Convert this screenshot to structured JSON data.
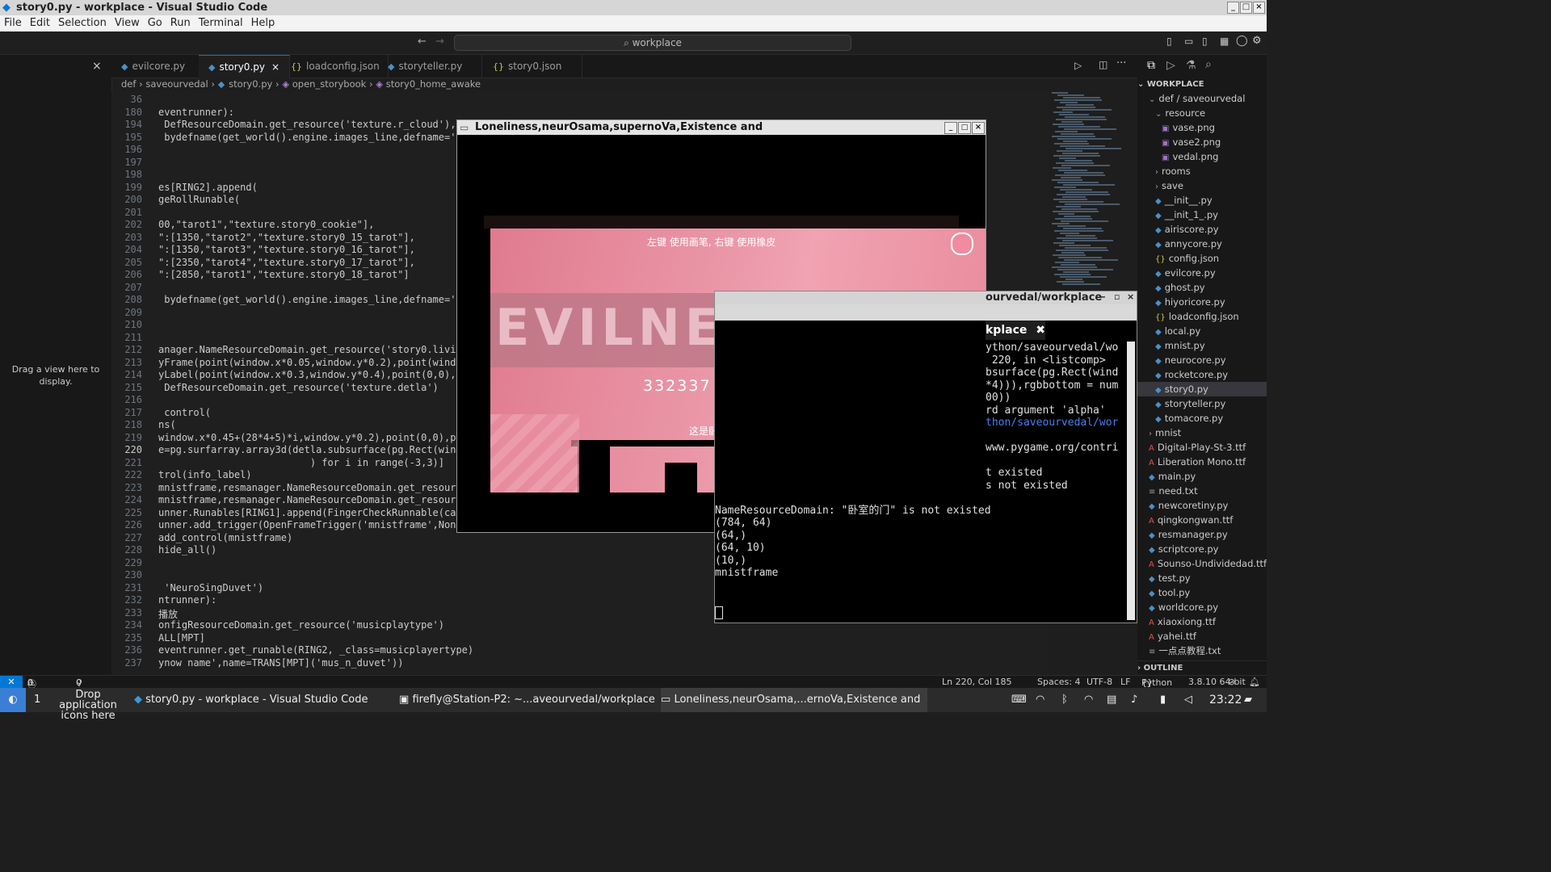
{
  "window": {
    "title": "story0.py - workplace - Visual Studio Code"
  },
  "menu": [
    "File",
    "Edit",
    "Selection",
    "View",
    "Go",
    "Run",
    "Terminal",
    "Help"
  ],
  "search": {
    "text": "workplace"
  },
  "left_panel": {
    "message": "Drag a view here to display."
  },
  "tabs": [
    {
      "label": "evilcore.py",
      "type": "py"
    },
    {
      "label": "story0.py",
      "type": "py",
      "active": true
    },
    {
      "label": "loadconfig.json",
      "type": "json"
    },
    {
      "label": "storyteller.py",
      "type": "py"
    },
    {
      "label": "story0.json",
      "type": "json"
    }
  ],
  "breadcrumb": [
    "def",
    "saveourvedal",
    "story0.py",
    "open_storybook",
    "story0_home_awake"
  ],
  "editor": {
    "lines": [
      {
        "n": "36",
        "code": ""
      },
      {
        "n": "180",
        "code": "eventrunner):"
      },
      {
        "n": "194",
        "code": " DefResourceDomain.get_resource('texture.r_cloud'),"
      },
      {
        "n": "195",
        "code": " bydefname(get_world().engine.images_line,defname='scre"
      },
      {
        "n": "196",
        "code": ""
      },
      {
        "n": "197",
        "code": ""
      },
      {
        "n": "198",
        "code": ""
      },
      {
        "n": "199",
        "code": "es[RING2].append("
      },
      {
        "n": "200",
        "code": "geRollRunable("
      },
      {
        "n": "201",
        "code": ""
      },
      {
        "n": "202",
        "code": "00,\"tarot1\",\"texture.story0_cookie\"],"
      },
      {
        "n": "203",
        "code": "\":[1350,\"tarot2\",\"texture.story0_15_tarot\"],"
      },
      {
        "n": "204",
        "code": "\":[1350,\"tarot3\",\"texture.story0_16_tarot\"],"
      },
      {
        "n": "205",
        "code": "\":[2350,\"tarot4\",\"texture.story0_17_tarot\"],"
      },
      {
        "n": "206",
        "code": "\":[2850,\"tarot1\",\"texture.story0_18_tarot\"]"
      },
      {
        "n": "207",
        "code": ""
      },
      {
        "n": "208",
        "code": " bydefname(get_world().engine.images_line,defname='cook"
      },
      {
        "n": "209",
        "code": ""
      },
      {
        "n": "210",
        "code": ""
      },
      {
        "n": "211",
        "code": ""
      },
      {
        "n": "212",
        "code": "anager.NameResourceDomain.get_resource('story0.livingro"
      },
      {
        "n": "213",
        "code": "yFrame(point(window.x*0.05,window.y*0.2),point(window.x"
      },
      {
        "n": "214",
        "code": "yLabel(point(window.x*0.3,window.y*0.4),point(0,0),'',3"
      },
      {
        "n": "215",
        "code": " DefResourceDomain.get_resource('texture.detla')"
      },
      {
        "n": "216",
        "code": ""
      },
      {
        "n": "217",
        "code": " control("
      },
      {
        "n": "218",
        "code": "ns("
      },
      {
        "n": "219",
        "code": "window.x*0.45+(28*4+5)*i,window.y*0.2),point(0,0),point"
      },
      {
        "n": "220",
        "code": "e=pg.surfarray.array3d(detla.subsurface(pg.Rect(window"
      },
      {
        "n": "221",
        "code": "                          ) for i in range(-3,3)]"
      },
      {
        "n": "222",
        "code": "trol(info_label)"
      },
      {
        "n": "223",
        "code": "mnistframe,resmanager.NameResourceDomain.get_resource('s"
      },
      {
        "n": "224",
        "code": "mnistframe,resmanager.NameResourceDomain.get_resource('s"
      },
      {
        "n": "225",
        "code": "unner.Runables[RING1].append(FingerCheckRunnable(canvas"
      },
      {
        "n": "226",
        "code": "unner.add_trigger(OpenFrameTrigger('mnistframe',None,'mnistframe'))"
      },
      {
        "n": "227",
        "code": "add_control(mnistframe)"
      },
      {
        "n": "228",
        "code": "hide_all()"
      },
      {
        "n": "229",
        "code": ""
      },
      {
        "n": "230",
        "code": ""
      },
      {
        "n": "231",
        "code": " 'NeuroSingDuvet')"
      },
      {
        "n": "232",
        "code": "ntrunner):"
      },
      {
        "n": "233",
        "code": "播放"
      },
      {
        "n": "234",
        "code": "onfigResourceDomain.get_resource('musicplaytype')"
      },
      {
        "n": "235",
        "code": "ALL[MPT]"
      },
      {
        "n": "236",
        "code": "eventrunner.get_runable(RING2, _class=musicplayertype)"
      },
      {
        "n": "237",
        "code": "ynow name',name=TRANS[MPT]('mus_n_duvet'))"
      }
    ]
  },
  "explorer": {
    "title": "WORKPLACE",
    "items": [
      {
        "label": "def / saveourvedal",
        "kind": "folder-open",
        "indent": 1
      },
      {
        "label": "resource",
        "kind": "folder-open",
        "indent": 2
      },
      {
        "label": "vase.png",
        "kind": "img",
        "indent": 3
      },
      {
        "label": "vase2.png",
        "kind": "img",
        "indent": 3
      },
      {
        "label": "vedal.png",
        "kind": "img",
        "indent": 3
      },
      {
        "label": "rooms",
        "kind": "folder",
        "indent": 2
      },
      {
        "label": "save",
        "kind": "folder",
        "indent": 2
      },
      {
        "label": "__init__.py",
        "kind": "py",
        "indent": 2
      },
      {
        "label": "__init_1_.py",
        "kind": "py",
        "indent": 2
      },
      {
        "label": "airiscore.py",
        "kind": "py",
        "indent": 2
      },
      {
        "label": "annycore.py",
        "kind": "py",
        "indent": 2
      },
      {
        "label": "config.json",
        "kind": "json",
        "indent": 2
      },
      {
        "label": "evilcore.py",
        "kind": "py",
        "indent": 2
      },
      {
        "label": "ghost.py",
        "kind": "py",
        "indent": 2
      },
      {
        "label": "hiyoricore.py",
        "kind": "py",
        "indent": 2
      },
      {
        "label": "loadconfig.json",
        "kind": "json",
        "indent": 2
      },
      {
        "label": "local.py",
        "kind": "py",
        "indent": 2
      },
      {
        "label": "mnist.py",
        "kind": "py",
        "indent": 2
      },
      {
        "label": "neurocore.py",
        "kind": "py",
        "indent": 2
      },
      {
        "label": "rocketcore.py",
        "kind": "py",
        "indent": 2
      },
      {
        "label": "story0.py",
        "kind": "py",
        "indent": 2,
        "selected": true
      },
      {
        "label": "storyteller.py",
        "kind": "py",
        "indent": 2
      },
      {
        "label": "tomacore.py",
        "kind": "py",
        "indent": 2
      },
      {
        "label": "mnist",
        "kind": "folder",
        "indent": 1
      },
      {
        "label": "Digital-Play-St-3.ttf",
        "kind": "ttf",
        "indent": 1
      },
      {
        "label": "Liberation Mono.ttf",
        "kind": "ttf",
        "indent": 1
      },
      {
        "label": "main.py",
        "kind": "py",
        "indent": 1
      },
      {
        "label": "need.txt",
        "kind": "txt",
        "indent": 1
      },
      {
        "label": "newcoretiny.py",
        "kind": "py",
        "indent": 1
      },
      {
        "label": "qingkongwan.ttf",
        "kind": "ttf",
        "indent": 1
      },
      {
        "label": "resmanager.py",
        "kind": "py",
        "indent": 1
      },
      {
        "label": "scriptcore.py",
        "kind": "py",
        "indent": 1
      },
      {
        "label": "Sounso-Undividedad.ttf",
        "kind": "ttf",
        "indent": 1
      },
      {
        "label": "test.py",
        "kind": "py",
        "indent": 1
      },
      {
        "label": "tool.py",
        "kind": "py",
        "indent": 1
      },
      {
        "label": "worldcore.py",
        "kind": "py",
        "indent": 1
      },
      {
        "label": "xiaoxiong.ttf",
        "kind": "ttf",
        "indent": 1
      },
      {
        "label": "yahei.ttf",
        "kind": "ttf",
        "indent": 1
      },
      {
        "label": "一点点教程.txt",
        "kind": "txt",
        "indent": 1
      }
    ],
    "outline_label": "OUTLINE"
  },
  "game_window": {
    "title": "Loneliness,neurOsama,supernoVa,Existence and",
    "hint": "左键 使用画笔, 右键 使用橡皮",
    "score": "332337",
    "caption": "这是卧室",
    "banner": "EVILNEURO"
  },
  "terminal_window": {
    "title": "ourvedal/workplace",
    "tab_label": "kplace",
    "lines": [
      "ython/saveourvedal/wo",
      " 220, in <listcomp>",
      "bsurface(pg.Rect(wind",
      "*4))),rgbbottom = num",
      "00))",
      "rd argument 'alpha'",
      "thon/saveourvedal/wor",
      "",
      "www.pygame.org/contri",
      "",
      "t existed",
      "s not existed",
      "",
      "NameResourceDomain: \"卧室的门\" is not existed",
      "(784, 64)",
      "(64,)",
      "(64, 10)",
      "(10,)",
      "mnistframe"
    ]
  },
  "status": {
    "errors": "0",
    "warnings": "0",
    "ports": "0",
    "position": "Ln 220, Col 185",
    "spaces": "Spaces: 4",
    "encoding": "UTF-8",
    "eol": "LF",
    "language": "Python",
    "interpreter": "3.8.10 64-bit"
  },
  "taskbar": {
    "workspace": "1",
    "drop_hint": "Drop application icons here",
    "tasks": [
      "story0.py - workplace - Visual Studio Code",
      "firefly@Station-P2: ~...aveourvedal/workplace",
      "Loneliness,neurOsama,...ernoVa,Existence and"
    ],
    "clock": "23:22"
  },
  "colors": {
    "accent": "#0078d4",
    "game_bg": "#e88ea0",
    "editor_bg": "#1f1f1f"
  }
}
